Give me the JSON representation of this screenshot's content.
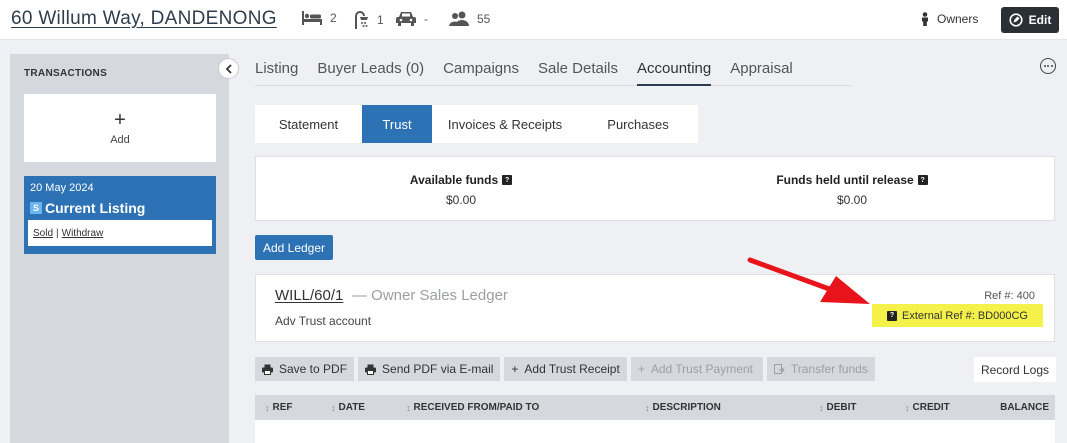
{
  "header": {
    "address": "60 Willum Way, DANDENONG",
    "bedrooms": "2",
    "bathrooms": "1",
    "cars": "-",
    "people": "55",
    "owners_label": "Owners",
    "edit_label": "Edit"
  },
  "sidebar": {
    "title": "TRANSACTIONS",
    "add_plus": "+",
    "add_label": "Add",
    "listing": {
      "date": "20 May 2024",
      "badge": "S",
      "title": "Current Listing",
      "link_sold": "Sold",
      "separator": "|",
      "link_withdraw": "Withdraw"
    }
  },
  "main_tabs": [
    {
      "label": "Listing"
    },
    {
      "label": "Buyer Leads (0)"
    },
    {
      "label": "Campaigns"
    },
    {
      "label": "Sale Details"
    },
    {
      "label": "Accounting"
    },
    {
      "label": "Appraisal"
    }
  ],
  "sub_tabs": [
    {
      "label": "Statement"
    },
    {
      "label": "Trust"
    },
    {
      "label": "Invoices & Receipts"
    },
    {
      "label": "Purchases"
    }
  ],
  "funds": {
    "available_label": "Available funds",
    "available_value": "$0.00",
    "held_label": "Funds held until release",
    "held_value": "$0.00"
  },
  "add_ledger_label": "Add Ledger",
  "ledger": {
    "code": "WILL/60/1",
    "name": "— Owner Sales Ledger",
    "account": "Adv Trust account",
    "ref": "Ref #: 400",
    "external_ref": "External Ref #: BD000CG"
  },
  "toolbar": {
    "save_pdf": "Save to PDF",
    "send_pdf": "Send PDF via E-mail",
    "add_receipt": "Add Trust Receipt",
    "add_payment": "Add Trust Payment",
    "transfer": "Transfer funds",
    "record_logs": "Record Logs"
  },
  "table": {
    "columns": [
      "REF",
      "DATE",
      "RECEIVED FROM/PAID TO",
      "DESCRIPTION",
      "DEBIT",
      "CREDIT",
      "BALANCE"
    ]
  },
  "colors": {
    "primary": "#2d72b5",
    "highlight": "#f4f24a",
    "arrow": "#e8131b",
    "dark_button": "#2b2f36"
  }
}
